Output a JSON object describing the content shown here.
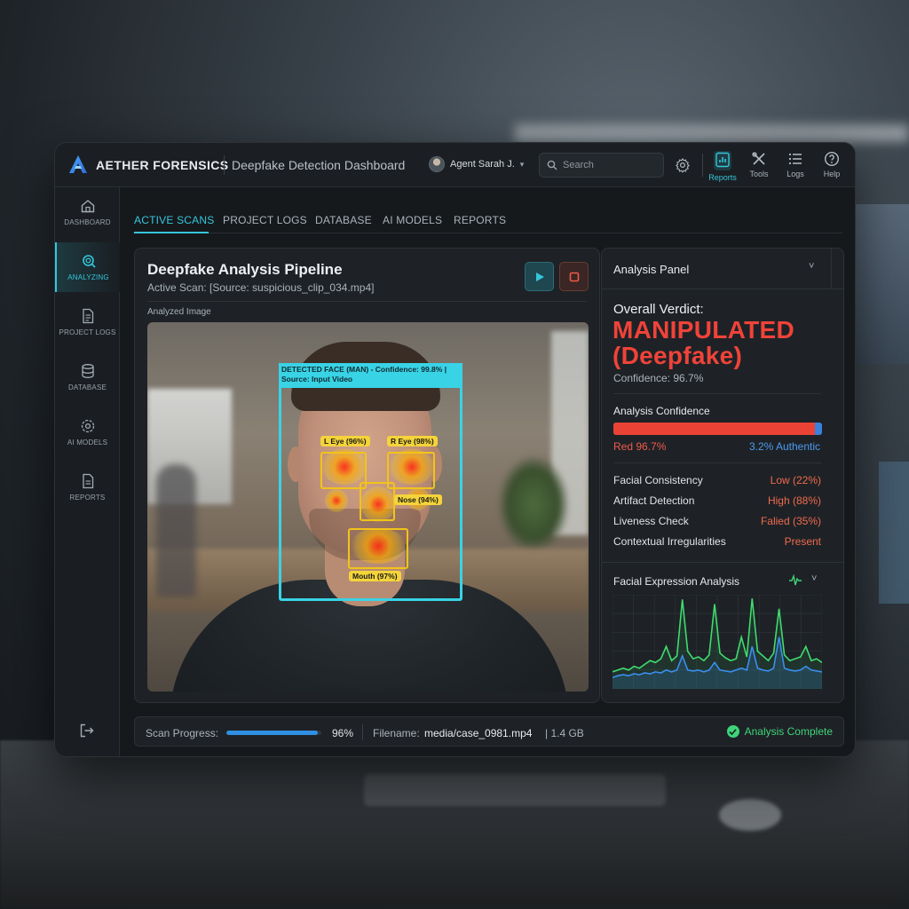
{
  "app": {
    "brand": "AETHER FORENSICS",
    "title": "Deepfake Detection Dashboard",
    "user": "Agent Sarah J.",
    "search_placeholder": "Search",
    "accent_color": "#35c6db"
  },
  "topnav": [
    {
      "label": "Reports",
      "icon": "chart-report-icon",
      "active": true
    },
    {
      "label": "Tools",
      "icon": "tools-icon"
    },
    {
      "label": "Logs",
      "icon": "list-icon"
    },
    {
      "label": "Help",
      "icon": "help-icon"
    }
  ],
  "sidebar": [
    {
      "label": "DASHBOARD",
      "icon": "home-icon"
    },
    {
      "label": "ANALYZING",
      "icon": "scan-icon",
      "active": true
    },
    {
      "label": "PROJECT LOGS",
      "icon": "document-icon"
    },
    {
      "label": "DATABASE",
      "icon": "database-icon"
    },
    {
      "label": "AI MODELS",
      "icon": "gear-icon"
    },
    {
      "label": "REPORTS",
      "icon": "report-icon"
    }
  ],
  "tabs": [
    "ACTIVE SCANS",
    "PROJECT LOGS",
    "DATABASE",
    "AI MODELS",
    "REPORTS"
  ],
  "pipeline": {
    "title": "Deepfake Analysis Pipeline",
    "subtitle": "Active Scan: [Source: suspicious_clip_034.mp4]",
    "image_label": "Analyzed Image",
    "face_label": "DETECTED FACE (MAN) - Confidence: 99.8% | Source: Input Video",
    "features": {
      "left_eye": "L Eye (96%)",
      "right_eye": "R Eye (98%)",
      "nose": "Nose (94%)",
      "mouth": "Mouth (97%)"
    }
  },
  "analysis": {
    "title": "Analysis Panel",
    "verdict_label": "Overall Verdict:",
    "verdict_line1": "MANIPULATED",
    "verdict_line2": "(Deepfake)",
    "confidence": "Confidence: 96.7%",
    "confidence_title": "Analysis Confidence",
    "red_fraction": 0.967,
    "red_label": "Red 96.7%",
    "blue_label": "3.2% Authentic",
    "verdict_color": "#f0433a",
    "metrics": [
      {
        "key": "Facial Consistency",
        "value": "Low (22%)"
      },
      {
        "key": "Artifact Detection",
        "value": "High (88%)"
      },
      {
        "key": "Liveness Check",
        "value": "Falied (35%)"
      },
      {
        "key": "Contextual Irregularities",
        "value": "Present"
      }
    ],
    "expression_title": "Facial Expression Analysis"
  },
  "chart_data": {
    "type": "line",
    "title": "Facial Expression Analysis",
    "series": [
      {
        "values": [
          0.18,
          0.2,
          0.22,
          0.2,
          0.24,
          0.22,
          0.26,
          0.3,
          0.28,
          0.32,
          0.45,
          0.3,
          0.35,
          0.95,
          0.4,
          0.32,
          0.34,
          0.3,
          0.36,
          0.9,
          0.38,
          0.33,
          0.3,
          0.32,
          0.55,
          0.34,
          0.96,
          0.4,
          0.35,
          0.3,
          0.38,
          0.85,
          0.36,
          0.3,
          0.32,
          0.34,
          0.45,
          0.3,
          0.32,
          0.28
        ]
      },
      {
        "values": [
          0.12,
          0.14,
          0.15,
          0.14,
          0.16,
          0.15,
          0.17,
          0.16,
          0.18,
          0.17,
          0.2,
          0.18,
          0.2,
          0.35,
          0.2,
          0.19,
          0.2,
          0.18,
          0.2,
          0.28,
          0.2,
          0.19,
          0.18,
          0.2,
          0.22,
          0.2,
          0.45,
          0.22,
          0.2,
          0.19,
          0.22,
          0.55,
          0.22,
          0.2,
          0.19,
          0.2,
          0.24,
          0.2,
          0.19,
          0.18
        ]
      }
    ],
    "ylim": [
      0,
      1
    ],
    "grid": true
  },
  "status": {
    "progress_label": "Scan Progress:",
    "progress": 0.96,
    "progress_text": "96%",
    "filename_label": "Filename:",
    "filename": "media/case_0981.mp4",
    "filesize": "| 1.4 GB",
    "complete": "Analysis Complete"
  }
}
